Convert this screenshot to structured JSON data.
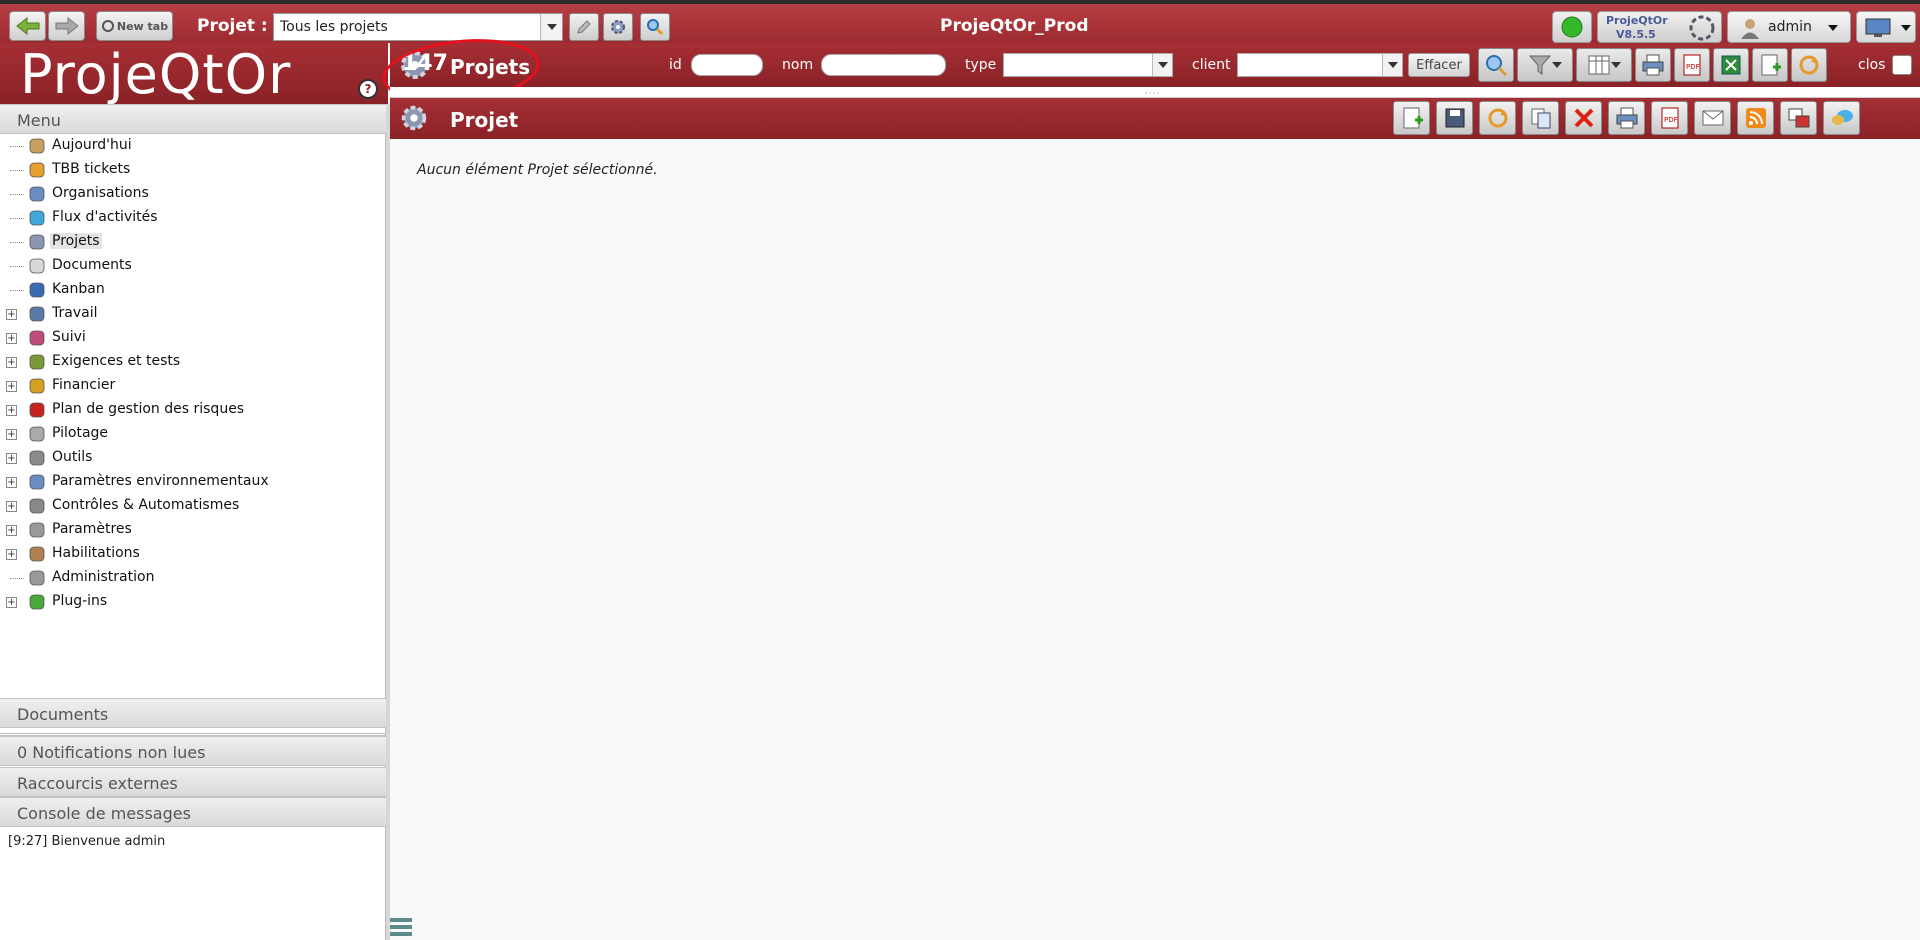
{
  "topbar": {
    "new_tab_label": "New tab",
    "project_label": "Projet :",
    "project_value": "Tous les projets",
    "app_title": "ProjeQtOr_Prod",
    "version_line1": "ProjeQtOr",
    "version_line2": "V8.5.5",
    "user_name": "admin"
  },
  "logo": {
    "text": "ProjeQtOr"
  },
  "list": {
    "count": "147",
    "title": "Projets",
    "filters": {
      "id_label": "id",
      "name_label": "nom",
      "type_label": "type",
      "client_label": "client",
      "clear_label": "Effacer",
      "closed_label": "clos"
    }
  },
  "detail": {
    "title": "Projet",
    "empty_message": "Aucun élément Projet sélectionné."
  },
  "left": {
    "menu_title": "Menu",
    "menu_items": [
      {
        "label": "Aujourd'hui",
        "expandable": false,
        "icon": "clock-icon"
      },
      {
        "label": "TBB tickets",
        "expandable": false,
        "icon": "ticket-icon"
      },
      {
        "label": "Organisations",
        "expandable": false,
        "icon": "organization-icon"
      },
      {
        "label": "Flux d'activités",
        "expandable": false,
        "icon": "activity-stream-icon"
      },
      {
        "label": "Projets",
        "expandable": false,
        "icon": "gear-icon",
        "selected": true
      },
      {
        "label": "Documents",
        "expandable": false,
        "icon": "document-icon"
      },
      {
        "label": "Kanban",
        "expandable": false,
        "icon": "kanban-icon"
      },
      {
        "label": "Travail",
        "expandable": true,
        "icon": "computer-icon"
      },
      {
        "label": "Suivi",
        "expandable": true,
        "icon": "tracking-icon"
      },
      {
        "label": "Exigences et tests",
        "expandable": true,
        "icon": "requirements-icon"
      },
      {
        "label": "Financier",
        "expandable": true,
        "icon": "money-bag-icon"
      },
      {
        "label": "Plan de gestion des risques",
        "expandable": true,
        "icon": "risk-icon"
      },
      {
        "label": "Pilotage",
        "expandable": true,
        "icon": "steering-icon"
      },
      {
        "label": "Outils",
        "expandable": true,
        "icon": "tools-icon"
      },
      {
        "label": "Paramètres environnementaux",
        "expandable": true,
        "icon": "environment-icon"
      },
      {
        "label": "Contrôles & Automatismes",
        "expandable": true,
        "icon": "automation-icon"
      },
      {
        "label": "Paramètres",
        "expandable": true,
        "icon": "wrench-icon"
      },
      {
        "label": "Habilitations",
        "expandable": true,
        "icon": "habilitation-icon"
      },
      {
        "label": "Administration",
        "expandable": false,
        "icon": "database-icon"
      },
      {
        "label": "Plug-ins",
        "expandable": true,
        "icon": "plugin-icon"
      }
    ],
    "documents_title": "Documents",
    "notifications_title": "0 Notifications non lues",
    "shortcuts_title": "Raccourcis externes",
    "console_title": "Console de messages",
    "console_message": "[9:27] Bienvenue admin"
  },
  "colors": {
    "header_red": "#9c2a30",
    "accent_red_circle": "#e8101c"
  }
}
